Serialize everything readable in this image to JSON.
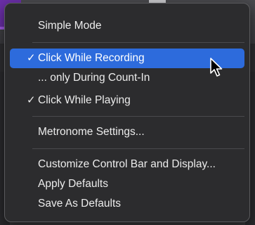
{
  "menu": {
    "items": [
      {
        "label": "Simple Mode",
        "checked": false
      },
      {
        "label": "Click While Recording",
        "checked": true
      },
      {
        "label": "... only During Count-In",
        "checked": false
      },
      {
        "label": "Click While Playing",
        "checked": true
      },
      {
        "label": "Metronome Settings...",
        "checked": false
      },
      {
        "label": "Customize Control Bar and Display...",
        "checked": false
      },
      {
        "label": "Apply Defaults",
        "checked": false
      },
      {
        "label": "Save As Defaults",
        "checked": false
      }
    ],
    "check_glyph": "✓"
  },
  "colors": {
    "highlight": "#2d6bdc",
    "menu_background": "#2c2c2e"
  },
  "icons": {
    "cursor": "arrow-pointer-icon"
  }
}
